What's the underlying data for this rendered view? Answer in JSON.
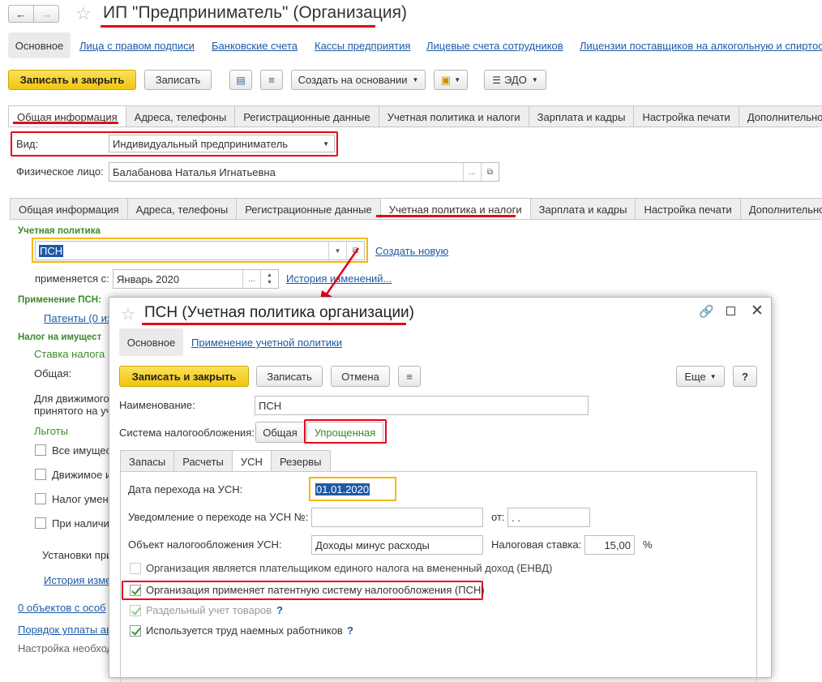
{
  "nav": {
    "back": "←",
    "forward": "→"
  },
  "main": {
    "title": "ИП \"Предприниматель\" (Организация)",
    "sections": [
      "Основное",
      "Лица с правом подписи",
      "Банковские счета",
      "Кассы предприятия",
      "Лицевые счета сотрудников",
      "Лицензии поставщиков на алкогольную и спиртос"
    ],
    "toolbar": {
      "save_close": "Записать и закрыть",
      "save": "Записать",
      "create_based": "Создать на основании",
      "edo": "ЭДО"
    },
    "tabs1": [
      "Общая информация",
      "Адреса, телефоны",
      "Регистрационные данные",
      "Учетная политика и налоги",
      "Зарплата и кадры",
      "Настройка печати",
      "Дополнительно"
    ],
    "vid_label": "Вид:",
    "vid_value": "Индивидуальный предприниматель",
    "person_label": "Физическое лицо:",
    "person_value": "Балабанова Наталья Игнатьевна",
    "tabs2": [
      "Общая информация",
      "Адреса, телефоны",
      "Регистрационные данные",
      "Учетная политика и налоги",
      "Зарплата и кадры",
      "Настройка печати",
      "Дополнительно"
    ],
    "policy_label": "Учетная политика",
    "policy_value": "ПСН",
    "create_new": "Создать новую",
    "applies_label": "применяется с:",
    "applies_value": "Январь 2020",
    "history": "История изменений...",
    "psn_label": "Применение ПСН:",
    "patents_link": "Патенты (0 из",
    "property_tax": "Налог на имущест",
    "rate_label": "Ставка налога",
    "general": "Общая:",
    "movable": "Для движимого",
    "accepted": "принятого на уч",
    "benefits": "Льготы",
    "cb_all": "Все имущес",
    "cb_movable": "Движимое и",
    "cb_reduce": "Налог умен",
    "cb_when": "При наличи",
    "settings_text": "Установки при",
    "history2": "История изме",
    "objects_link": "0 объектов с особ",
    "order_link": "Порядок уплаты ав",
    "setup_text": "Настройка необход"
  },
  "dialog": {
    "title": "ПСН (Учетная политика организации)",
    "sections": [
      "Основное",
      "Применение учетной политики"
    ],
    "save_close": "Записать и закрыть",
    "save": "Записать",
    "cancel": "Отмена",
    "more": "Еще",
    "help": "?",
    "name_label": "Наименование:",
    "name_value": "ПСН",
    "tax_system_label": "Система налогообложения:",
    "tax_general": "Общая",
    "tax_simplified": "Упрощенная",
    "tabs": [
      "Запасы",
      "Расчеты",
      "УСН",
      "Резервы"
    ],
    "date_label": "Дата перехода на УСН:",
    "date_value": "01.01.2020",
    "notice_label": "Уведомление о переходе на УСН №:",
    "notice_value": "",
    "from_label": "от:",
    "from_value": " .  .",
    "object_label": "Объект налогообложения УСН:",
    "object_value": "Доходы минус расходы",
    "rate_label": "Налоговая ставка:",
    "rate_value": "15,00",
    "percent": "%",
    "cb_envd": "Организация является плательщиком единого налога на вмененный доход (ЕНВД)",
    "cb_psn": "Организация применяет патентную систему налогообложения (ПСН)",
    "cb_separate": "Раздельный учет товаров",
    "cb_hired": "Используется труд наемных работников",
    "q": "?"
  },
  "colors": {
    "red": "#e8001c",
    "yellow": "#f1c40f",
    "link": "#1c5aa6",
    "green": "#3a8a2a",
    "orange": "#f4b800"
  }
}
